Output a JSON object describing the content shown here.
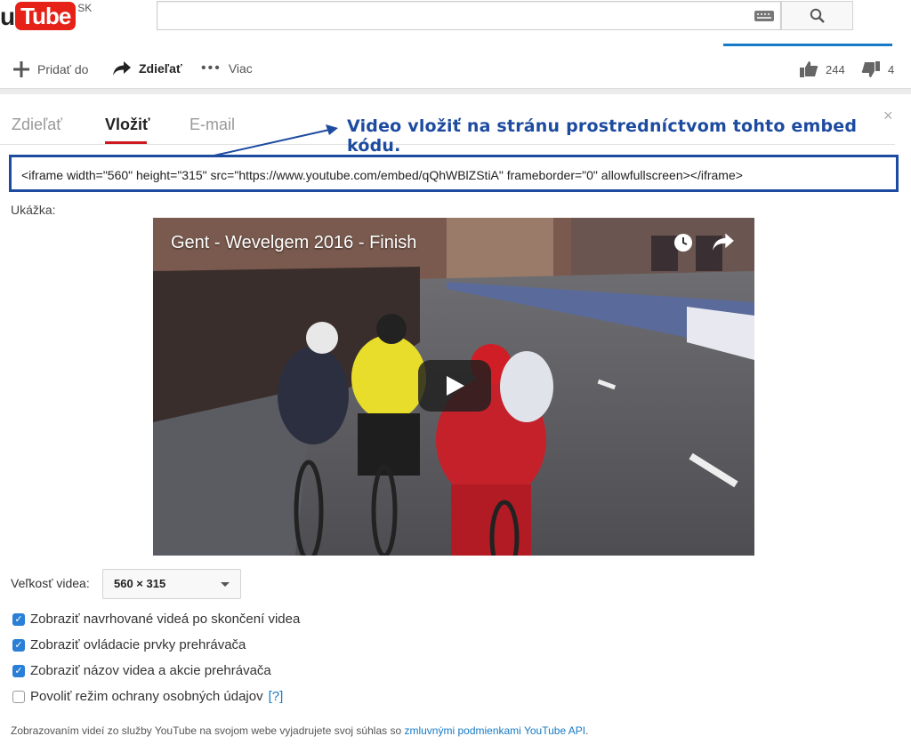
{
  "masthead": {
    "logo_prefix": "u",
    "logo_tube": "Tube",
    "logo_region": "SK",
    "search_placeholder": "",
    "icons": [
      "keyboard-icon",
      "search-icon"
    ]
  },
  "action_bar": {
    "add_label": "Pridať do",
    "share_label": "Zdieľať",
    "more_label": "Viac",
    "like_count": "244",
    "dislike_count": "4"
  },
  "tabs": [
    {
      "label": "Zdieľať",
      "active": false
    },
    {
      "label": "Vložiť",
      "active": true
    },
    {
      "label": "E-mail",
      "active": false
    }
  ],
  "close_symbol": "×",
  "annotation": "Video vložiť na stránu prostredníctvom tohto embed kódu.",
  "embed": {
    "code": "<iframe width=\"560\" height=\"315\" src=\"https://www.youtube.com/embed/qQhWBlZStiA\" frameborder=\"0\" allowfullscreen></iframe>"
  },
  "preview": {
    "label": "Ukážka:",
    "video_title": "Gent - Wevelgem 2016 - Finish"
  },
  "size": {
    "label": "Veľkosť videa:",
    "value": "560 × 315"
  },
  "options": [
    {
      "label": "Zobraziť navrhované videá po skončení videa",
      "checked": true
    },
    {
      "label": "Zobraziť ovládacie prvky prehrávača",
      "checked": true
    },
    {
      "label": "Zobraziť názov videa a akcie prehrávača",
      "checked": true
    },
    {
      "label": "Povoliť režim ochrany osobných údajov",
      "checked": false,
      "help": "[?]"
    }
  ],
  "footer": {
    "text": "Zobrazovaním videí zo služby YouTube na svojom webe vyjadrujete svoj súhlas so ",
    "link": "zmluvnými podmienkami YouTube API",
    "end": "."
  },
  "colors": {
    "brand_red": "#e62117",
    "annotation_blue": "#1d4ba0",
    "link_blue": "#167ac6",
    "checkbox_blue": "#2a7fd6"
  }
}
